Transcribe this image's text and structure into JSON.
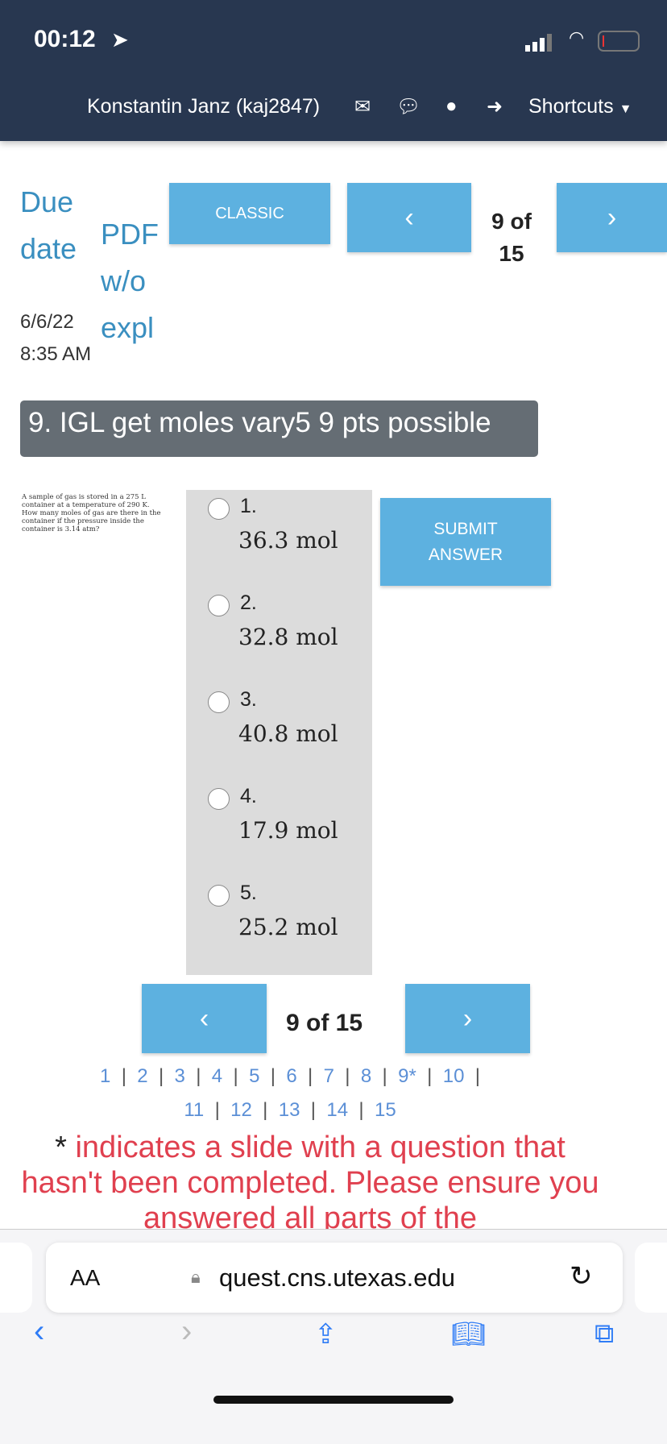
{
  "status_bar": {
    "time": "00:12"
  },
  "header": {
    "user": "Konstantin Janz (kaj2847)",
    "shortcuts": "Shortcuts"
  },
  "toolbar": {
    "due_label": "Due date",
    "pdf_label": "PDF w/o expl",
    "classic": "CLASSIC",
    "prev": "‹",
    "next": "›",
    "position": "9 of 15",
    "due_date": "6/6/22 8:35 AM"
  },
  "question": {
    "title": "9. IGL get moles vary5 9 pts possible",
    "text": "A sample of gas is stored in a 275 L container at a temperature of 290 K. How many moles of gas are there in the container if the pressure inside the container is 3.14 atm?",
    "choices": [
      {
        "num": "1.",
        "value": "36.3 mol"
      },
      {
        "num": "2.",
        "value": "32.8 mol"
      },
      {
        "num": "3.",
        "value": "40.8 mol"
      },
      {
        "num": "4.",
        "value": "17.9 mol"
      },
      {
        "num": "5.",
        "value": "25.2 mol"
      }
    ],
    "submit": "SUBMIT ANSWER"
  },
  "bottom_nav": {
    "position": "9 of 15",
    "pages": [
      "1",
      "2",
      "3",
      "4",
      "5",
      "6",
      "7",
      "8",
      "9*",
      "10",
      "11",
      "12",
      "13",
      "14",
      "15"
    ],
    "note_star": "*",
    "note": "indicates a slide with a question that hasn't been completed. Please ensure you answered all parts of the"
  },
  "safari": {
    "aa": "AA",
    "url": "quest.cns.utexas.edu"
  }
}
